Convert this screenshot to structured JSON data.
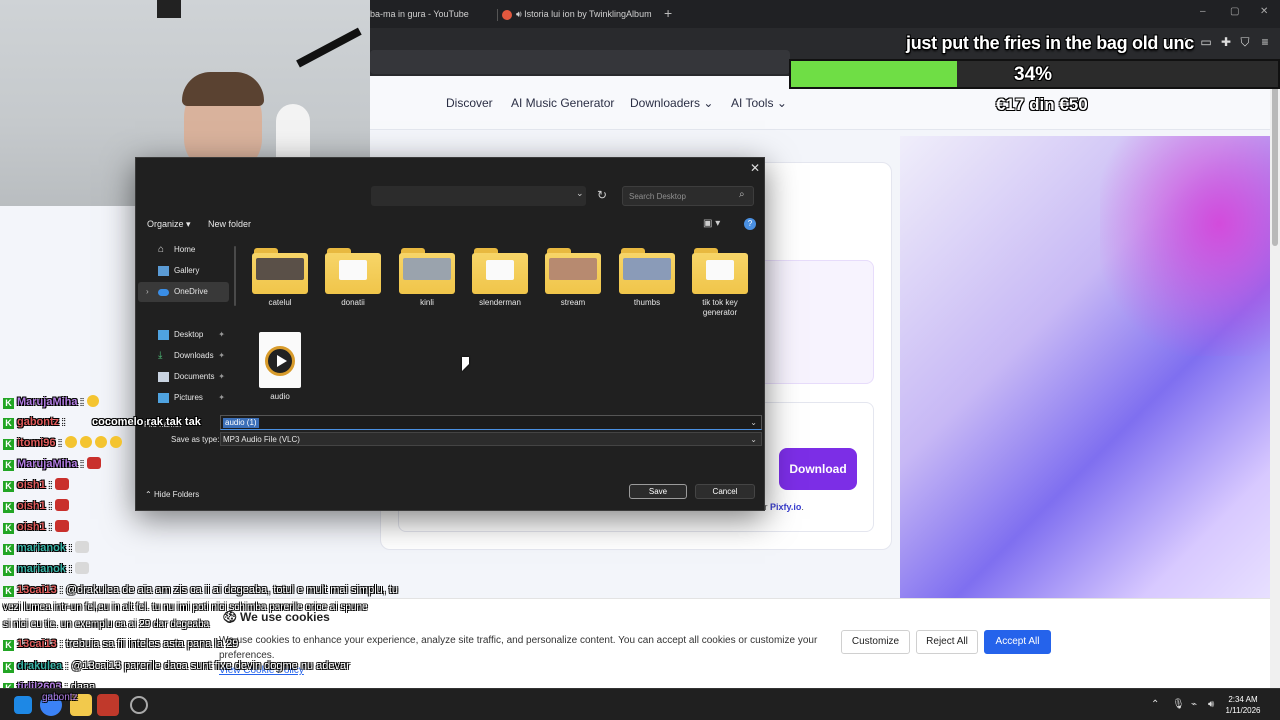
{
  "browser": {
    "tabs": [
      {
        "label": "ba-ma in gura - YouTube"
      },
      {
        "label": "Istoria lui ion by TwinklingAlbum"
      }
    ],
    "new_tab": "+",
    "window_controls": {
      "minimize": "–",
      "maximize": "▢",
      "close": "✕"
    }
  },
  "site": {
    "nav": [
      "Discover",
      "AI Music Generator",
      "Downloaders",
      "AI Tools"
    ],
    "download_label": "Download",
    "powered_prefix": "tor",
    "powered_brand": "Pixfy.io",
    "powered_suffix": "."
  },
  "cookie": {
    "title": "We use cookies",
    "text": "We use cookies to enhance your experience, analyze site traffic, and personalize content. You can accept all cookies or customize your preferences.",
    "link": "View Cookie Policy",
    "customize": "Customize",
    "reject": "Reject All",
    "accept": "Accept All"
  },
  "overlay": {
    "fries_text": "just put the fries in the bag old unc",
    "progress_percent": 34,
    "progress_label": "34%",
    "donation_text": "€17 din €50"
  },
  "dialog": {
    "search_placeholder": "Search Desktop",
    "organize": "Organize",
    "new_folder": "New folder",
    "help": "?",
    "nav_items": [
      {
        "label": "Home",
        "icon": "home-icon"
      },
      {
        "label": "Gallery",
        "icon": "gallery-icon"
      },
      {
        "label": "OneDrive",
        "icon": "cloud-icon"
      },
      {
        "label": "Desktop",
        "icon": "desktop-icon"
      },
      {
        "label": "Downloads",
        "icon": "download-icon"
      },
      {
        "label": "Documents",
        "icon": "document-icon"
      },
      {
        "label": "Pictures",
        "icon": "pictures-icon"
      }
    ],
    "files": [
      {
        "name": "catelul",
        "kind": "folder-photo",
        "thumb": "#5a5048"
      },
      {
        "name": "donatii",
        "kind": "folder-doc"
      },
      {
        "name": "kinli",
        "kind": "folder-photo",
        "thumb": "#9aa3ad"
      },
      {
        "name": "slenderman",
        "kind": "folder-doc"
      },
      {
        "name": "stream",
        "kind": "folder-photo",
        "thumb": "#b78a70"
      },
      {
        "name": "thumbs",
        "kind": "folder-photo",
        "thumb": "#8a9bb8"
      },
      {
        "name": "tik tok key generator",
        "kind": "folder-doc"
      },
      {
        "name": "audio",
        "kind": "media"
      }
    ],
    "filename_label": "File name:",
    "filename_value": "audio (1)",
    "savetype_label": "Save as type:",
    "savetype_value": "MP3 Audio File (VLC)",
    "hide_folders": "Hide Folders",
    "save": "Save",
    "cancel": "Cancel"
  },
  "chat": {
    "cocomelo": "cocomelo rak tak tak",
    "lines": [
      {
        "user": "MarujaMiha",
        "color": "#b07be0",
        "msg": ":",
        "emotes": [
          "laugh"
        ]
      },
      {
        "user": "gabontz",
        "color": "#e05a5a",
        "msg": ":",
        "emotes": []
      },
      {
        "user": "itomi96",
        "color": "#e05a5a",
        "msg": ":",
        "emotes": [
          "laugh",
          "laugh",
          "laugh",
          "laugh"
        ]
      },
      {
        "user": "MarujaMiha",
        "color": "#b07be0",
        "msg": ":",
        "emotes": [
          "red"
        ]
      },
      {
        "user": "oish1",
        "color": "#e05a5a",
        "msg": ":",
        "emotes": [
          "red"
        ]
      },
      {
        "user": "oish1",
        "color": "#e05a5a",
        "msg": ":",
        "emotes": [
          "red"
        ]
      },
      {
        "user": "oish1",
        "color": "#e05a5a",
        "msg": ":",
        "emotes": [
          "red"
        ]
      },
      {
        "user": "marianok",
        "color": "#39b3a6",
        "msg": ":",
        "emotes": [
          "plain"
        ]
      },
      {
        "user": "marianok",
        "color": "#39b3a6",
        "msg": ":",
        "emotes": [
          "plain"
        ]
      },
      {
        "user": "13cai13",
        "color": "#e05a5a",
        "msg": ": @drakulea de aia am zis ca ii ai degeaba, totul e mult mai simplu, tu",
        "emotes": []
      },
      {
        "user": "13cai13",
        "color": "#e05a5a",
        "msg": ": trebuia sa fii inteles asta pana la 29",
        "emotes": []
      },
      {
        "user": "drakulea",
        "color": "#39b3a6",
        "msg": ": @13cai13 parerile daca sunt fixe devin dogme nu adevar",
        "emotes": []
      },
      {
        "user": "tirlil2603",
        "color": "#b07be0",
        "msg": ": daaa",
        "emotes": []
      }
    ],
    "wrap1": "vezi lumea intr-un fel,eu in alt fel. tu nu imi poti nici schimba parerile orice ai spune",
    "wrap2": "si nici eu tie. un exemplu ca ai 29 dar degeaba",
    "taskbar_name": "gabontz"
  },
  "taskbar": {
    "time": "2:34 AM",
    "date": "1/11/2026"
  }
}
